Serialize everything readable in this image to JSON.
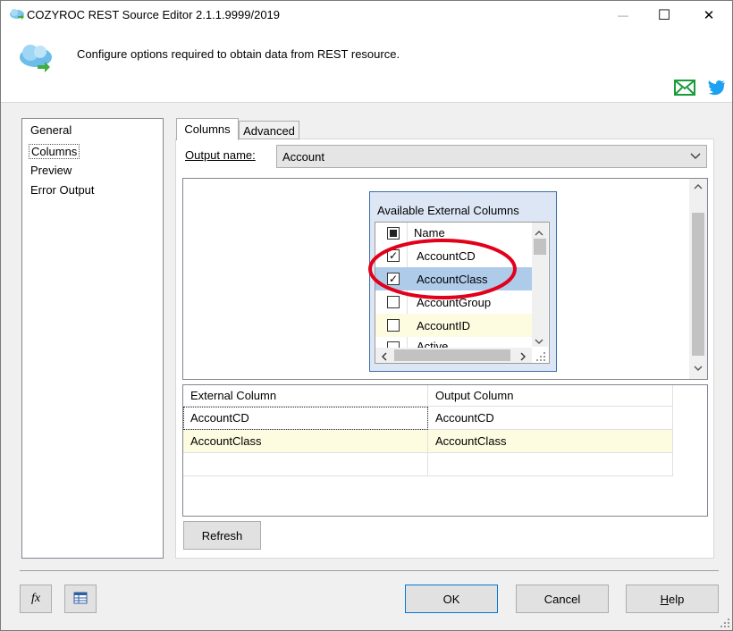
{
  "window": {
    "title": "COZYROC REST Source Editor 2.1.1.9999/2019",
    "minimize_glyph": "—",
    "maximize_glyph": "☐",
    "close_glyph": "✕"
  },
  "header": {
    "description": "Configure options required to obtain data from REST resource.",
    "icons": [
      "cloud-icon",
      "email-icon",
      "twitter-icon"
    ],
    "colors": {
      "email": "#1a9c3a",
      "twitter": "#1da1f2"
    }
  },
  "nav": {
    "items": [
      "General",
      "Columns",
      "Preview",
      "Error Output"
    ],
    "selected": "Columns"
  },
  "tabs": [
    {
      "label": "Columns",
      "active": true
    },
    {
      "label": "Advanced",
      "active": false
    }
  ],
  "output": {
    "label": "Output name:",
    "value": "Account"
  },
  "available_columns": {
    "title": "Available External Columns",
    "header": "Name",
    "rows": [
      {
        "name": "AccountCD",
        "checked": true
      },
      {
        "name": "AccountClass",
        "checked": true
      },
      {
        "name": "AccountGroup",
        "checked": false
      },
      {
        "name": "AccountID",
        "checked": false
      },
      {
        "name": "Active",
        "checked": false
      }
    ],
    "annotation_color": "#e2001a"
  },
  "mapping": {
    "headers": [
      "External Column",
      "Output Column"
    ],
    "rows": [
      {
        "external": "AccountCD",
        "output": "AccountCD"
      },
      {
        "external": "AccountClass",
        "output": "AccountClass"
      }
    ]
  },
  "buttons": {
    "refresh": "Refresh",
    "ok": "OK",
    "cancel": "Cancel",
    "help": "Help",
    "fx": "fx"
  }
}
